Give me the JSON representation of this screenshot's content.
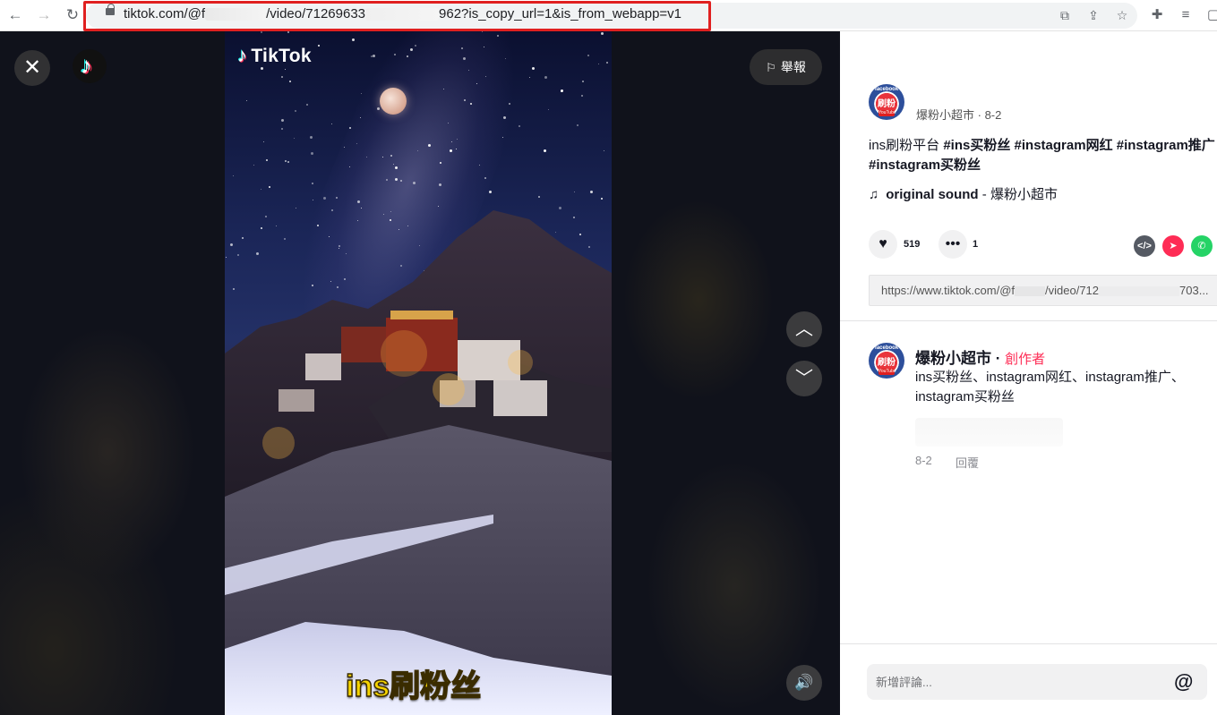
{
  "browser": {
    "url_prefix": "tiktok.com/@f",
    "url_mid": "/video/71269633",
    "url_suffix": "962?is_copy_url=1&is_from_webapp=v1"
  },
  "stage": {
    "brand_watermark": "TikTok",
    "video_caption": "ins刷粉丝",
    "report_label": "舉報"
  },
  "post": {
    "author": "爆粉小超市",
    "date": "8-2",
    "description_text": "ins刷粉平台 ",
    "hashtags": [
      "#ins买粉丝",
      "#instagram网红",
      "#instagram推广",
      "#instagram买粉丝"
    ],
    "sound_label": "original sound",
    "sound_author": "爆粉小超市",
    "like_count": "519",
    "comment_count": "1",
    "link_prefix": "https://www.tiktok.com/@f",
    "link_mid": "/video/712",
    "link_suffix": "703..."
  },
  "comments": [
    {
      "author": "爆粉小超市",
      "badge": "創作者",
      "text": "ins买粉丝、instagram网红、instagram推广、instagram买粉丝",
      "date": "8-2",
      "reply_label": "回覆"
    }
  ],
  "comment_input": {
    "placeholder": "新增評論..."
  },
  "colors": {
    "accent": "#fe2c55",
    "caption_yellow": "#f5d400",
    "url_highlight": "#e02020"
  }
}
